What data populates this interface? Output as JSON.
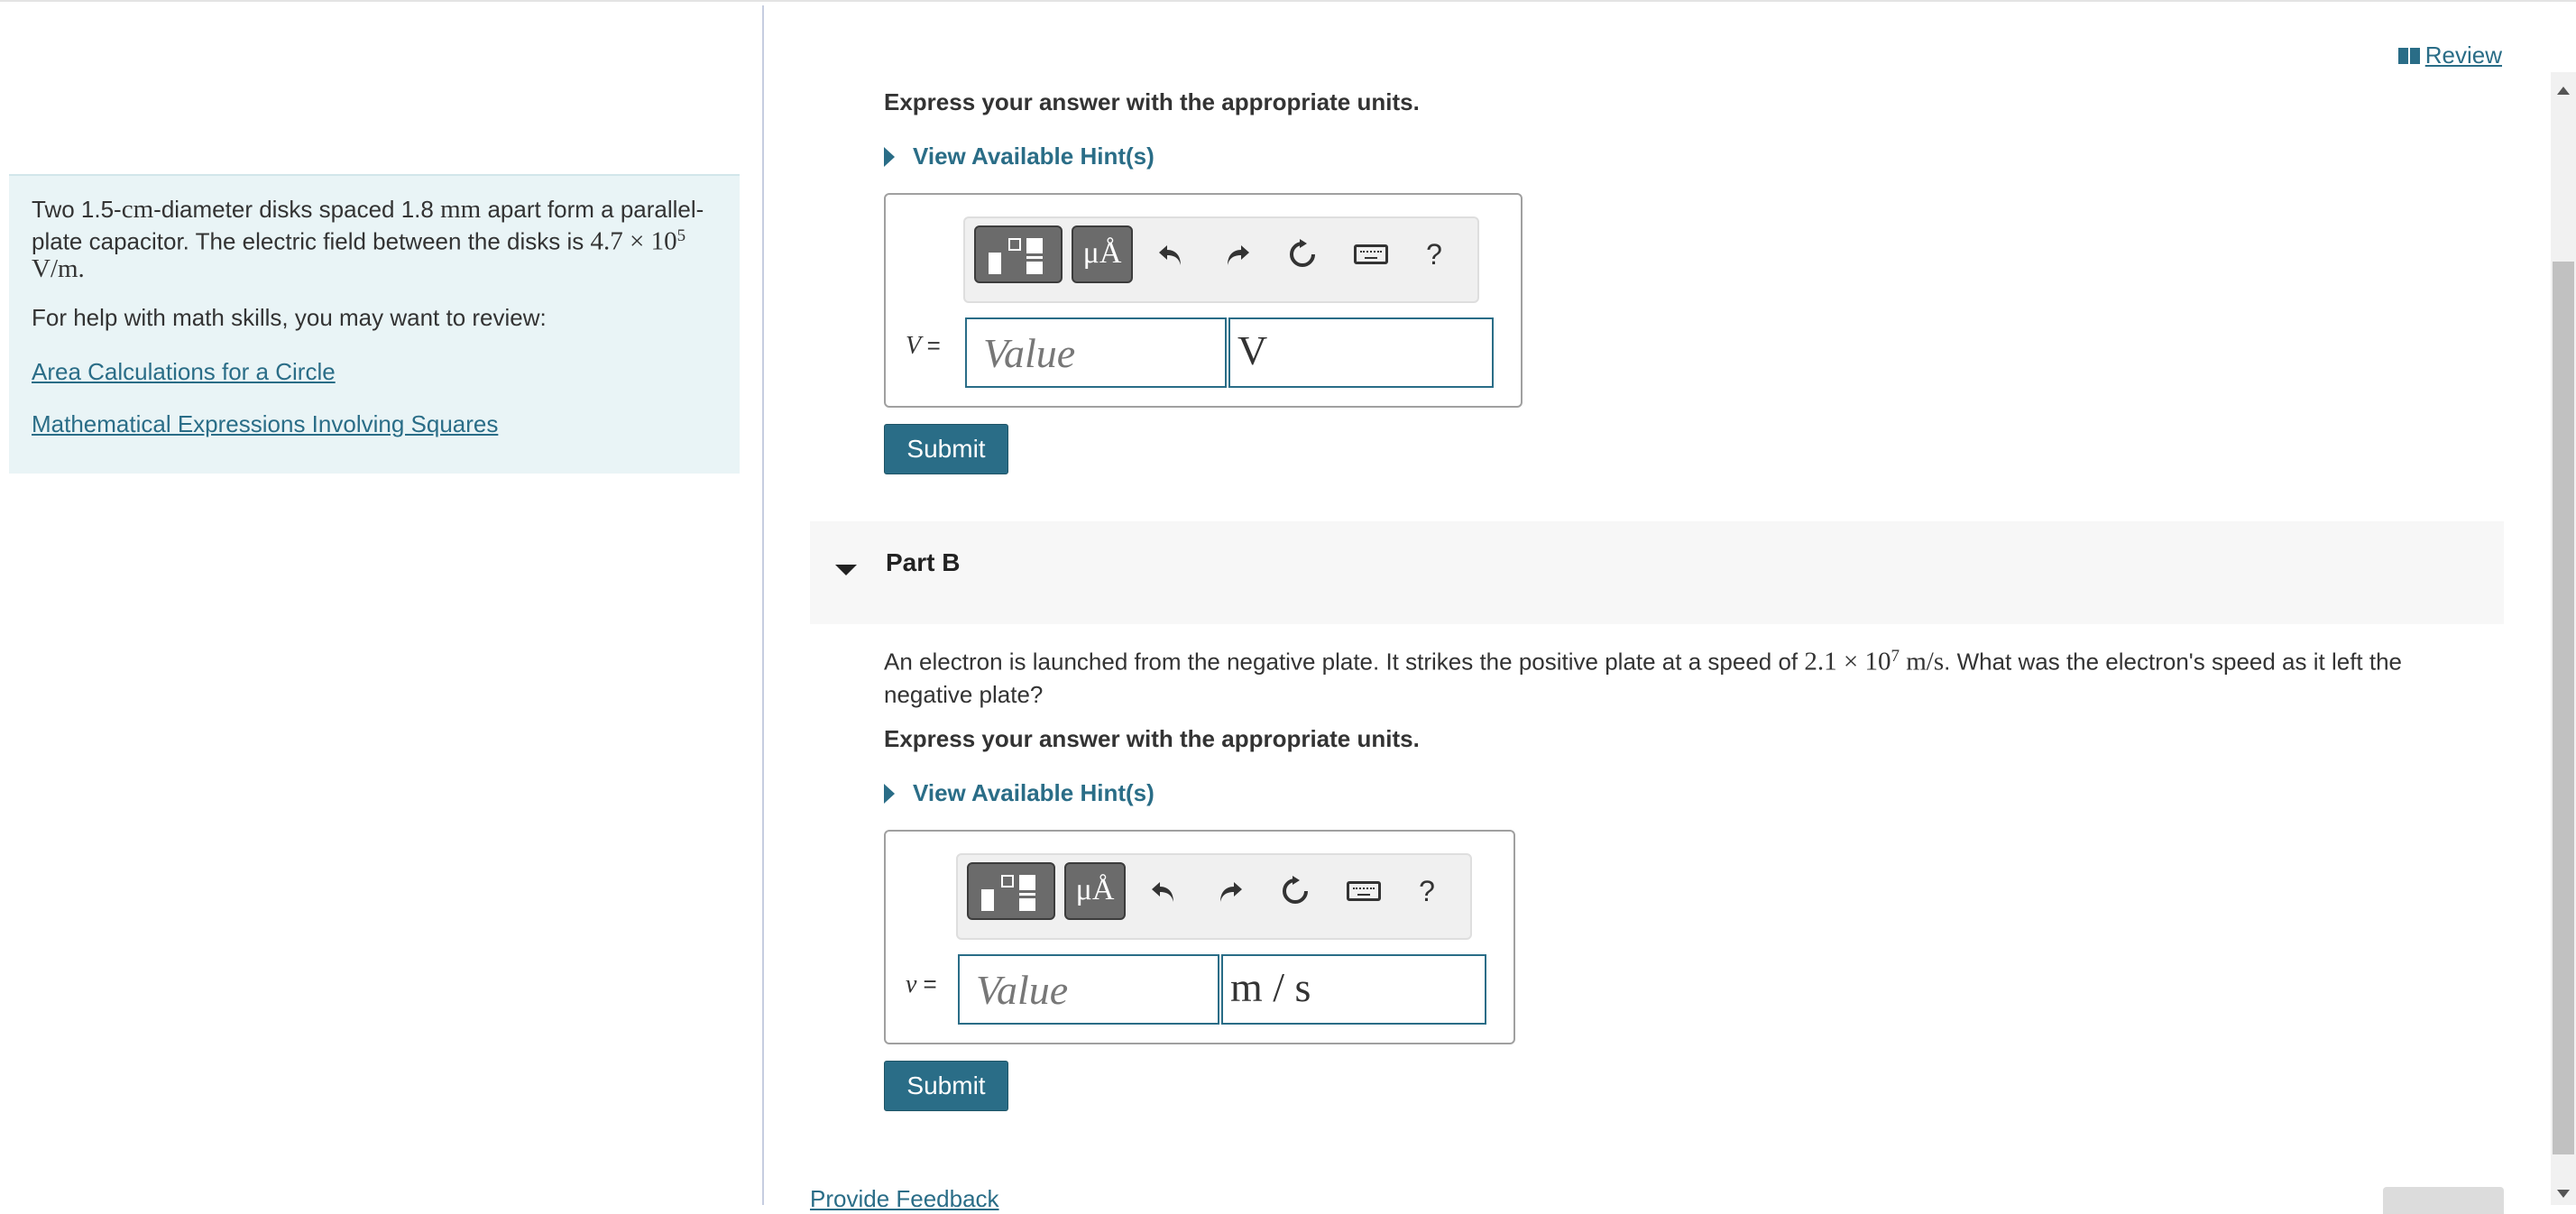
{
  "problem": {
    "intro_a": "Two 1.5-",
    "intro_cm": "cm",
    "intro_b": "-diameter disks spaced 1.8 ",
    "intro_mm": "mm",
    "intro_c": " apart form a parallel-plate capacitor. The electric field between the disks is ",
    "field_value": "4.7 × 10",
    "field_exp": "5",
    "field_unit": "V/m.",
    "help_text": "For help with math skills, you may want to review:",
    "links": [
      "Area Calculations for a Circle",
      "Mathematical Expressions Involving Squares"
    ]
  },
  "review_label": "Review",
  "part_a": {
    "units_instruction": "Express your answer with the appropriate units.",
    "hint_label": "View Available Hint(s)",
    "variable": "V",
    "equals": "=",
    "value_placeholder": "Value",
    "unit_value": "V",
    "submit_label": "Submit"
  },
  "part_b": {
    "title": "Part B",
    "question_a": "An electron is launched from the negative plate. It strikes the positive plate at a speed of ",
    "speed_value": "2.1 × 10",
    "speed_exp": "7",
    "speed_unit": "m/s",
    "question_b": ". What was the electron's speed as it left the negative plate?",
    "units_instruction": "Express your answer with the appropriate units.",
    "hint_label": "View Available Hint(s)",
    "variable": "v",
    "equals": "=",
    "value_placeholder": "Value",
    "unit_value": "m / s",
    "submit_label": "Submit"
  },
  "toolbar": {
    "units_button": "μÅ",
    "help_button": "?",
    "icons": [
      "templates-icon",
      "units-icon",
      "undo-icon",
      "redo-icon",
      "reset-icon",
      "keyboard-icon",
      "help-icon"
    ]
  },
  "feedback_label": "Provide Feedback",
  "colors": {
    "accent": "#2a6d87",
    "left_panel_bg": "#e9f4f6"
  }
}
